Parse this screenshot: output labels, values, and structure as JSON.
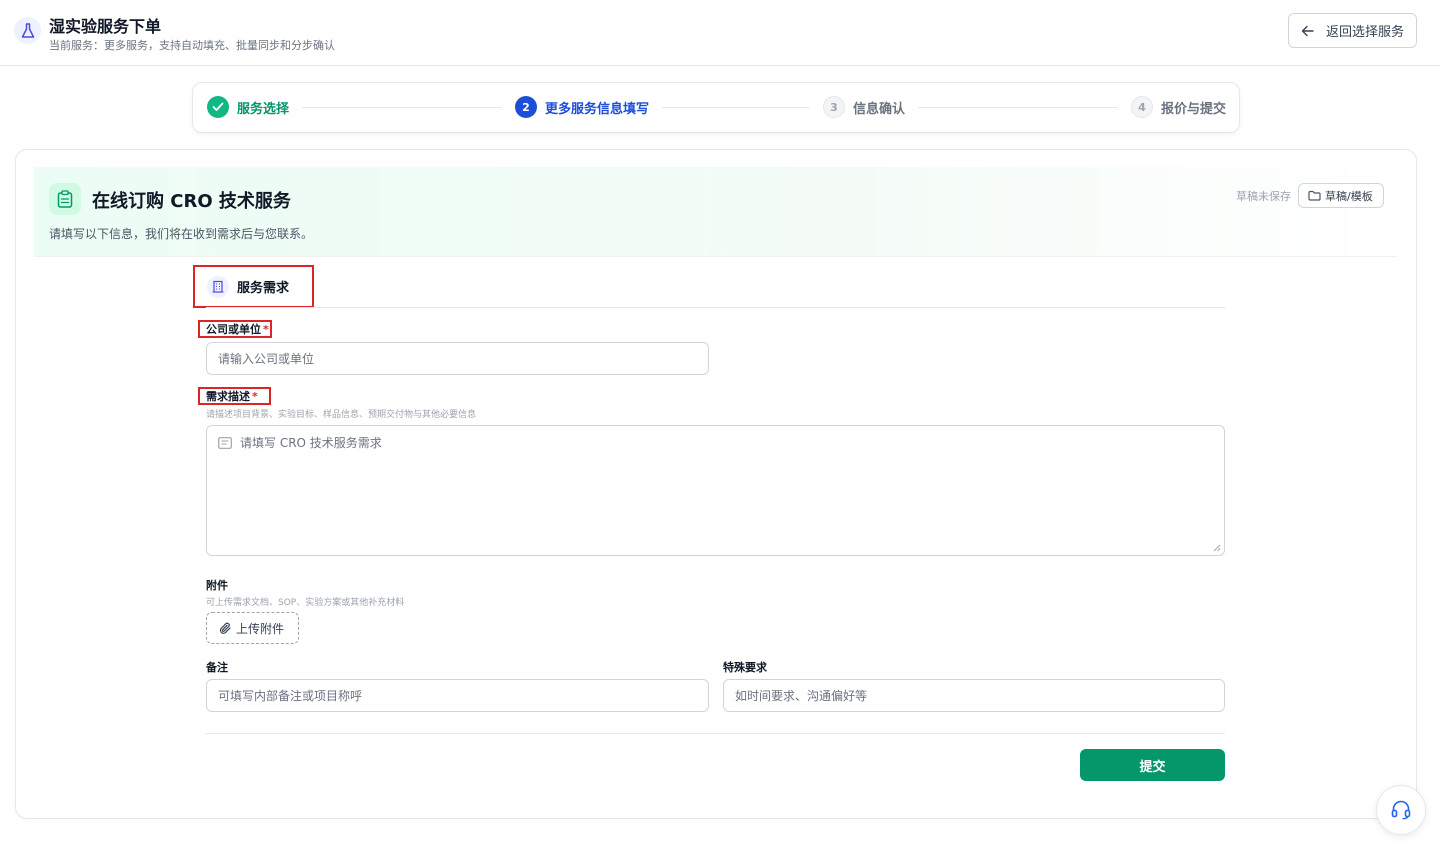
{
  "header": {
    "title": "湿实验服务下单",
    "subtitle": "当前服务：更多服务，支持自动填充、批量同步和分步确认",
    "back_label": "返回选择服务",
    "logo_icon": "flask-icon",
    "back_icon": "arrow-left-icon"
  },
  "stepper": {
    "steps": [
      {
        "num": "",
        "label": "服务选择",
        "state": "done"
      },
      {
        "num": "2",
        "label": "更多服务信息填写",
        "state": "active"
      },
      {
        "num": "3",
        "label": "信息确认",
        "state": "pending"
      },
      {
        "num": "4",
        "label": "报价与提交",
        "state": "pending"
      }
    ]
  },
  "hero": {
    "title": "在线订购 CRO 技术服务",
    "subtitle": "请填写以下信息，我们将在收到需求后与您联系。",
    "draft_status": "草稿未保存",
    "draft_button": "草稿/模板",
    "hero_icon": "clipboard-icon",
    "draft_icon": "folder-icon"
  },
  "form": {
    "section_title": "服务需求",
    "section_icon": "building-icon",
    "company": {
      "label": "公司或单位",
      "required_mark": "*",
      "placeholder": "请输入公司或单位"
    },
    "requirement": {
      "label": "需求描述",
      "required_mark": "*",
      "hint": "请描述项目背景、实验目标、样品信息、预期交付物与其他必要信息",
      "placeholder": "请填写 CRO 技术服务需求"
    },
    "attachment": {
      "label": "附件",
      "hint": "可上传需求文档、SOP、实验方案或其他补充材料",
      "button": "上传附件",
      "icon": "paperclip-icon"
    },
    "remark": {
      "label": "备注",
      "placeholder": "可填写内部备注或项目称呼"
    },
    "special": {
      "label": "特殊要求",
      "placeholder": "如时间要求、沟通偏好等"
    },
    "submit": "提交"
  },
  "support": {
    "icon": "headset-icon"
  },
  "colors": {
    "primary_green": "#059669",
    "active_blue": "#1d4ed8",
    "highlight_red": "#dc2626"
  }
}
